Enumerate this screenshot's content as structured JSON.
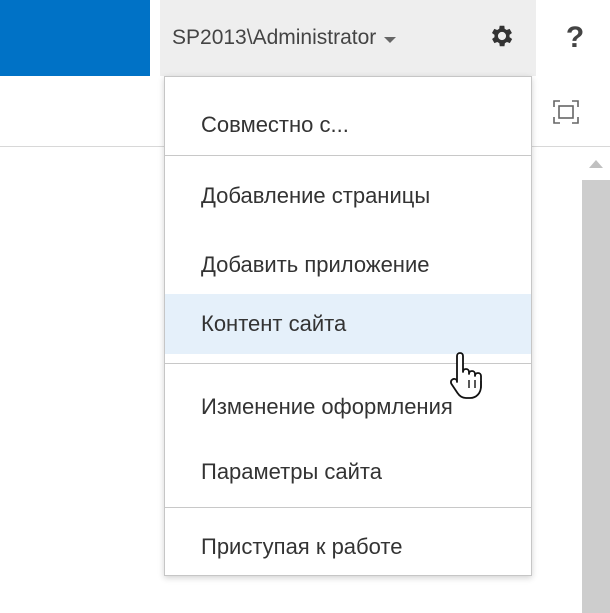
{
  "suite_bar": {
    "brand_color": "#0072c6",
    "user_name": "SP2013\\Administrator",
    "help_label": "?",
    "settings_icon": "gear-icon",
    "caret_icon": "chevron-down-icon"
  },
  "ribbon": {
    "focus_icon": "focus-on-content-icon"
  },
  "settings_menu": {
    "hover_color": "#e5f0fa",
    "items": [
      {
        "label": "Совместно с..."
      },
      {
        "label": "Добавление страницы"
      },
      {
        "label": "Добавить приложение"
      },
      {
        "label": "Контент сайта",
        "hovered": true
      },
      {
        "label": "Изменение оформления"
      },
      {
        "label": "Параметры сайта"
      },
      {
        "label": "Приступая к работе"
      }
    ]
  },
  "pointer": {
    "icon": "hand-pointer-icon"
  }
}
